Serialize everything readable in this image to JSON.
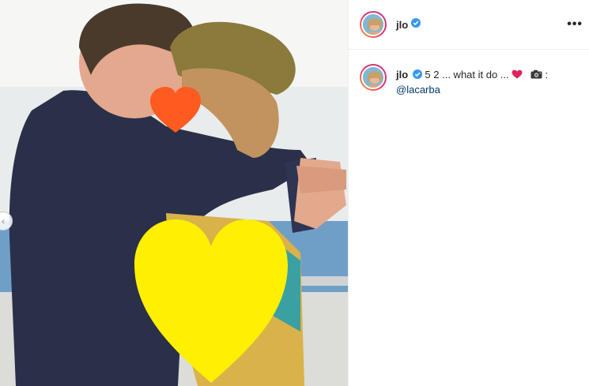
{
  "post": {
    "username": "jlo",
    "caption": "5 2 ... what it do ...",
    "caption_emojis": [
      "red-heart",
      "camera"
    ],
    "caption_suffix": ":",
    "mention": "@lacarba",
    "more_glyph": "•••",
    "prev_arrow": "‹"
  },
  "icons": {
    "verified": "verified-badge-icon",
    "more": "more-options-icon",
    "prev": "chevron-left-icon"
  },
  "colors": {
    "verified_blue": "#3897f0",
    "heart_yellow": "#ffef00",
    "heart_orange": "#ff5a1f"
  }
}
